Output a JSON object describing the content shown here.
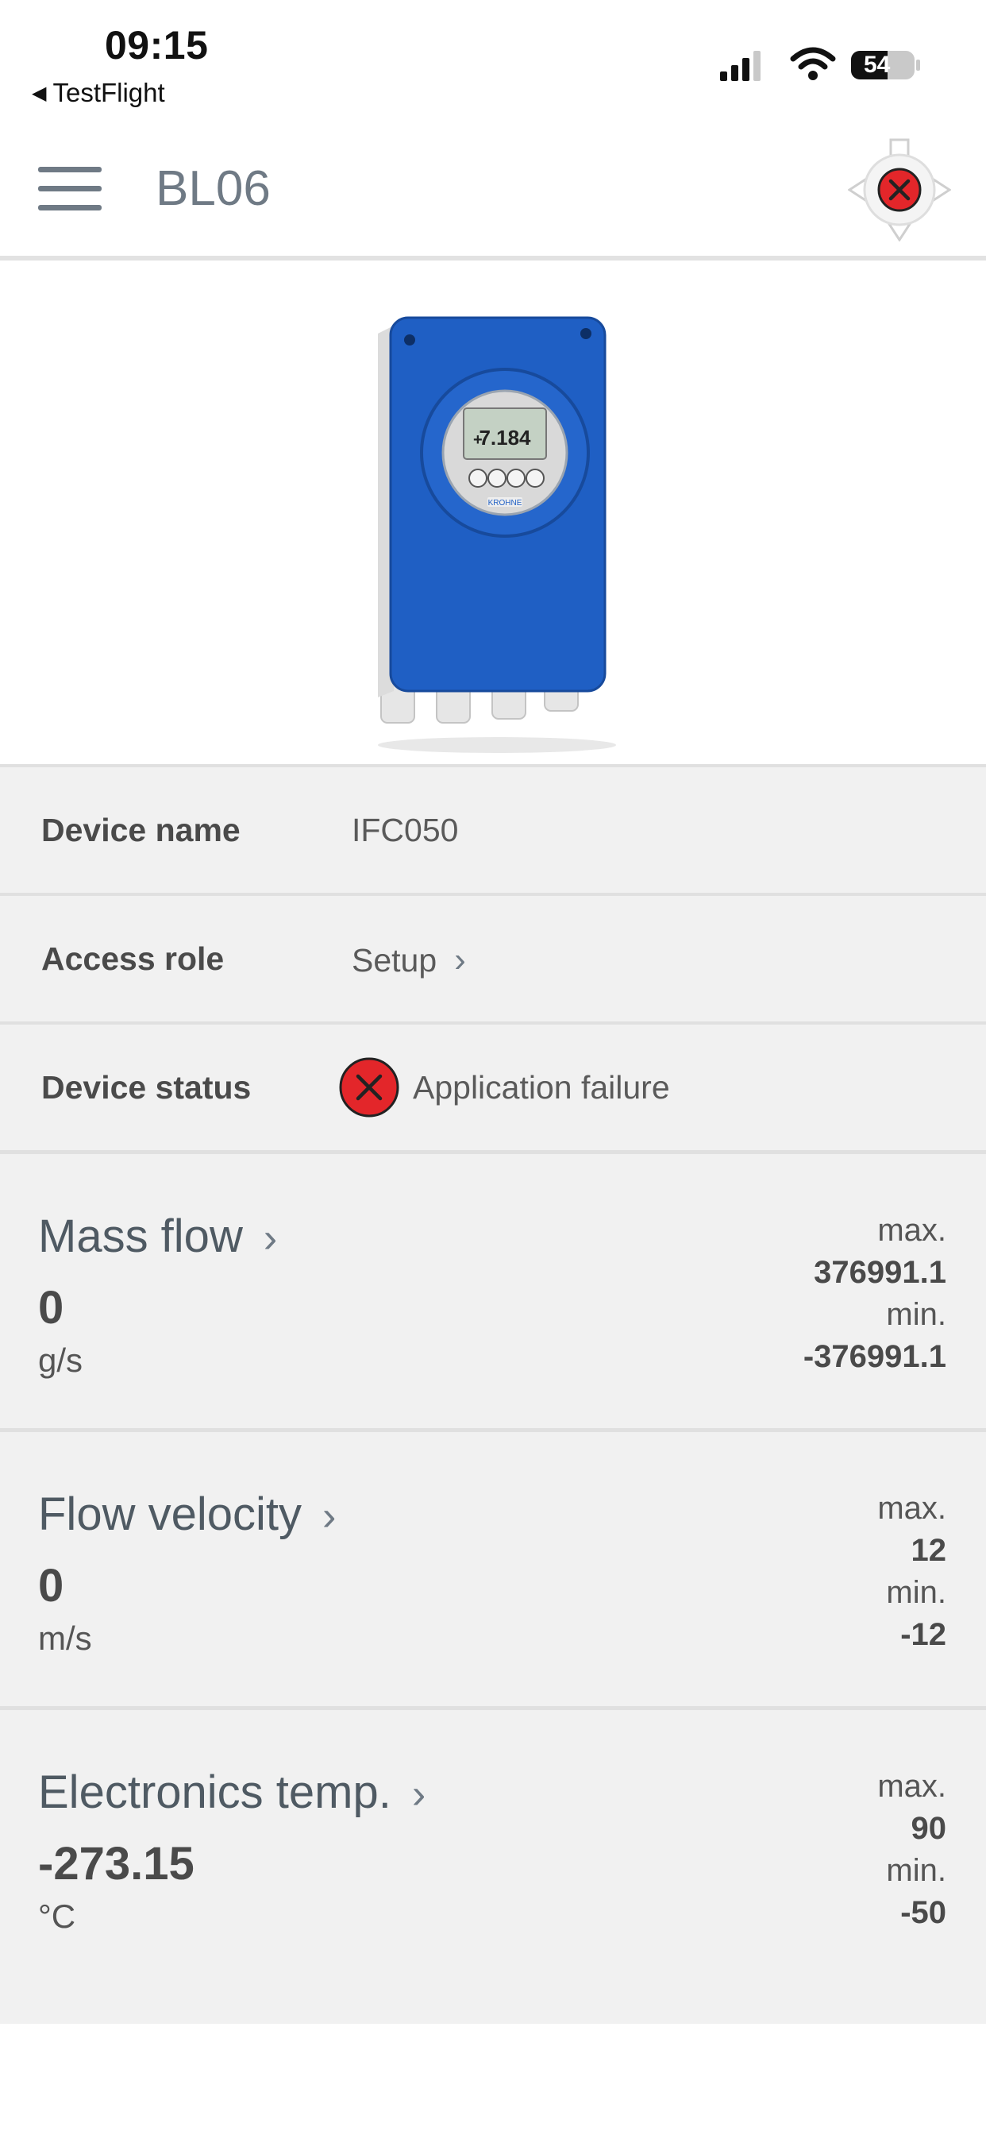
{
  "status_bar": {
    "time": "09:15",
    "back_app": "TestFlight",
    "battery": "54"
  },
  "header": {
    "title": "BL06",
    "connection_status_icon": "connection-error-icon"
  },
  "device": {
    "display_reading": "7.184",
    "brand": "KROHNE"
  },
  "info": {
    "device_name_label": "Device name",
    "device_name_value": "IFC050",
    "access_role_label": "Access role",
    "access_role_value": "Setup",
    "device_status_label": "Device status",
    "device_status_value": "Application failure"
  },
  "measurements": [
    {
      "title": "Mass flow",
      "value": "0",
      "unit": "g/s",
      "max_label": "max.",
      "max": "376991.1",
      "min_label": "min.",
      "min": "-376991.1"
    },
    {
      "title": "Flow velocity",
      "value": "0",
      "unit": "m/s",
      "max_label": "max.",
      "max": "12",
      "min_label": "min.",
      "min": "-12"
    },
    {
      "title": "Electronics temp.",
      "value": "-273.15",
      "unit": "°C",
      "max_label": "max.",
      "max": "90",
      "min_label": "min.",
      "min": "-50"
    }
  ],
  "colors": {
    "accent": "#6f7a85",
    "error_red": "#e3262a",
    "device_blue": "#1f5fc4",
    "row_background": "#f1f1f1"
  }
}
